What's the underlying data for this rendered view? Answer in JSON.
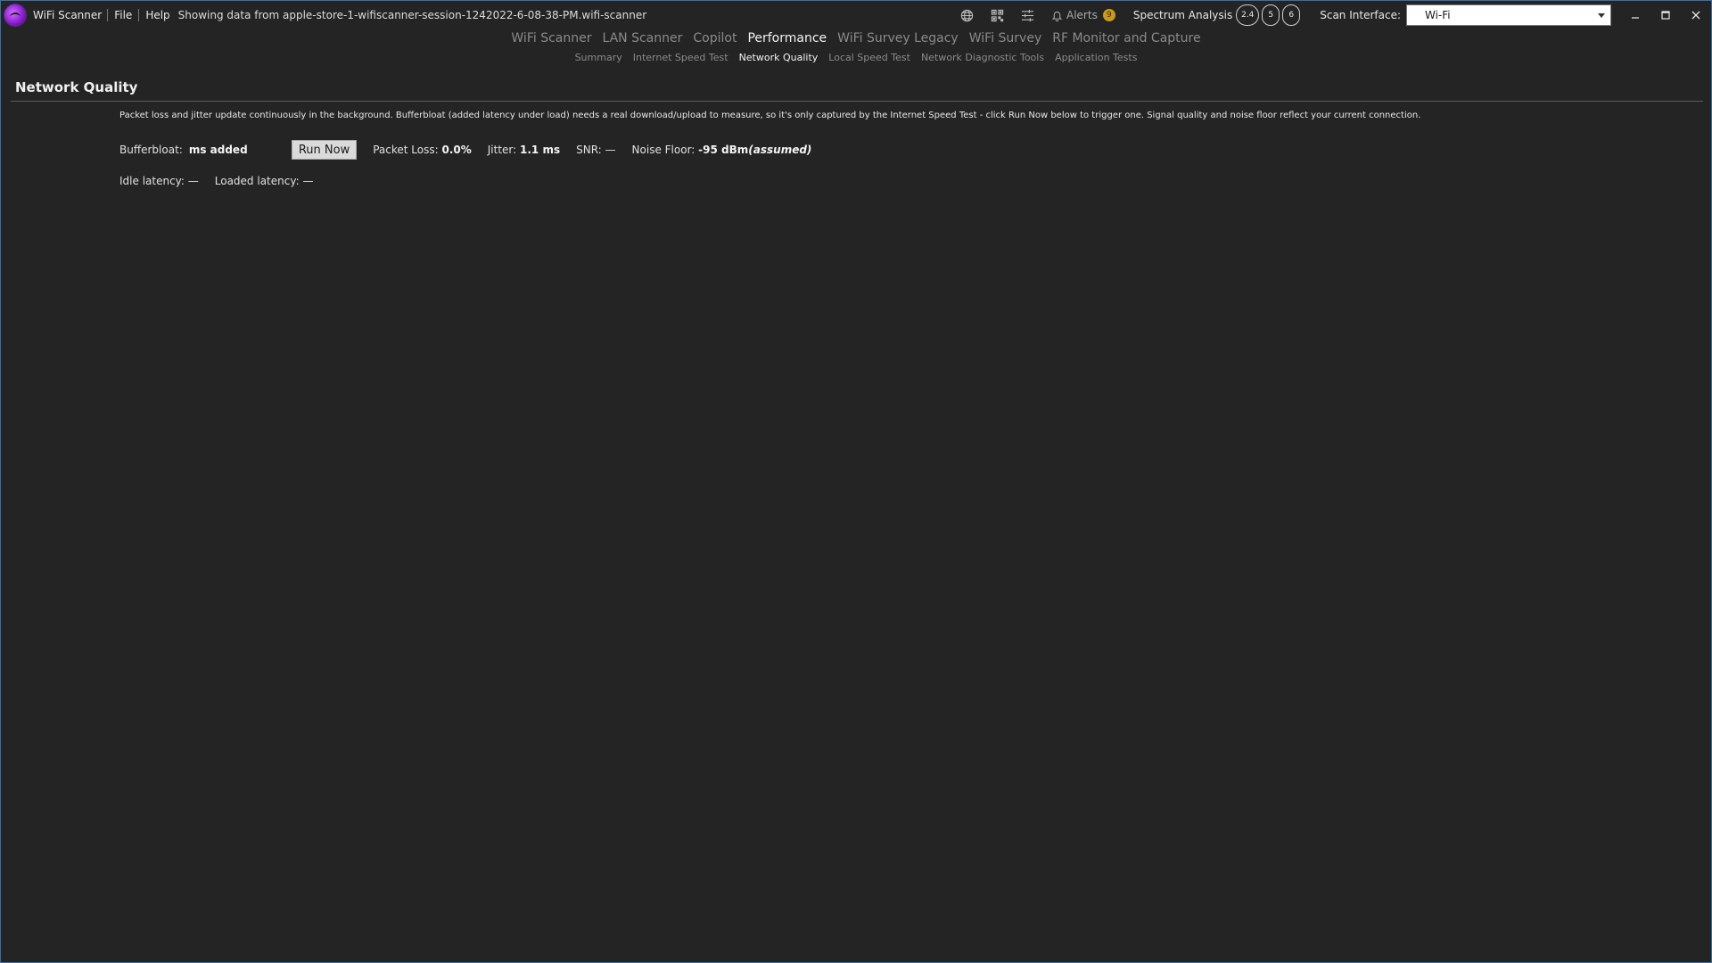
{
  "titlebar": {
    "app_name": "WiFi Scanner",
    "menu": [
      "File",
      "Help"
    ],
    "session": "Showing data from apple-store-1-wifiscanner-session-1242022-6-08-38-PM.wifi-scanner",
    "icons": [
      "globe-icon",
      "qr-code-icon",
      "sliders-icon",
      "bell-icon"
    ],
    "alerts_label": "Alerts",
    "alerts_count": "9",
    "spectrum_label": "Spectrum Analysis",
    "bands": [
      "2.4",
      "5",
      "6"
    ],
    "scan_interface_label": "Scan Interface:",
    "scan_interface_value": "Wi-Fi",
    "window_buttons": {
      "minimize": "−",
      "maximize": "□",
      "close": "✕"
    }
  },
  "nav": {
    "main_tabs": [
      {
        "label": "WiFi Scanner",
        "active": false
      },
      {
        "label": "LAN Scanner",
        "active": false
      },
      {
        "label": "Copilot",
        "active": false
      },
      {
        "label": "Performance",
        "active": true
      },
      {
        "label": "WiFi Survey Legacy",
        "active": false
      },
      {
        "label": "WiFi Survey",
        "active": false
      },
      {
        "label": "RF Monitor and Capture",
        "active": false
      }
    ],
    "sub_tabs": [
      {
        "label": "Summary",
        "active": false
      },
      {
        "label": "Internet Speed Test",
        "active": false
      },
      {
        "label": "Network Quality",
        "active": true
      },
      {
        "label": "Local Speed Test",
        "active": false
      },
      {
        "label": "Network Diagnostic Tools",
        "active": false
      },
      {
        "label": "Application Tests",
        "active": false
      }
    ]
  },
  "page": {
    "title": "Network Quality",
    "info": "Packet loss and jitter update continuously in the background. Bufferbloat (added latency under load) needs a real download/upload to measure, so it's only captured by the Internet Speed Test - click Run Now below to trigger one. Signal quality and noise floor reflect your current connection.",
    "bufferbloat_label": "Bufferbloat:",
    "bufferbloat_value": "ms added",
    "run_now": "Run Now",
    "packet_loss_label": "Packet Loss:",
    "packet_loss_value": "0.0%",
    "jitter_label": "Jitter:",
    "jitter_value": "1.1 ms",
    "snr_label": "SNR:",
    "snr_value": "—",
    "noise_floor_label": "Noise Floor:",
    "noise_floor_value": "-95 dBm",
    "noise_floor_note": "(assumed)",
    "idle_latency_label": "Idle latency:",
    "idle_latency_value": "—",
    "loaded_latency_label": "Loaded latency:",
    "loaded_latency_value": "—"
  },
  "colors": {
    "background": "#242424",
    "accent": "#9b30e0",
    "alert_badge": "#c99a1f",
    "window_border": "#3a6ea5"
  }
}
